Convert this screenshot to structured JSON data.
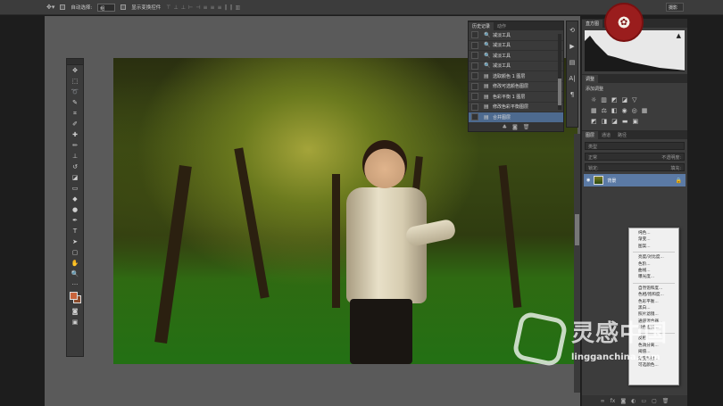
{
  "options_bar": {
    "auto_select_label": "自动选择:",
    "auto_select_value": "组",
    "show_transform_label": "显示变换控件",
    "workspace_value": "摄影"
  },
  "history_panel": {
    "tabs": [
      "历史记录",
      "动作"
    ],
    "items": [
      {
        "label": "减淡工具",
        "selected": false
      },
      {
        "label": "减淡工具",
        "selected": false
      },
      {
        "label": "减淡工具",
        "selected": false
      },
      {
        "label": "减淡工具",
        "selected": false
      },
      {
        "label": "选取颜色 1 图层",
        "selected": false
      },
      {
        "label": "修改可选颜色图层",
        "selected": false
      },
      {
        "label": "色彩平衡 1 图层",
        "selected": false
      },
      {
        "label": "修改色彩平衡图层",
        "selected": false
      },
      {
        "label": "合并图层",
        "selected": true
      }
    ]
  },
  "histogram_panel": {
    "tab": "直方图"
  },
  "adjustments_panel": {
    "tab": "调整",
    "title": "添加调整"
  },
  "layers_panel": {
    "tabs": [
      "图层",
      "通道",
      "路径"
    ],
    "kind_filter": "类型",
    "blend_mode": "正常",
    "opacity_label": "不透明度:",
    "lock_label": "锁定:",
    "fill_label": "填充:",
    "layer_name": "背景"
  },
  "context_menu": {
    "groups": [
      [
        "纯色...",
        "渐变...",
        "图案..."
      ],
      [
        "亮度/对比度...",
        "色阶...",
        "曲线...",
        "曝光度..."
      ],
      [
        "自然饱和度...",
        "色相/饱和度...",
        "色彩平衡...",
        "黑白...",
        "照片滤镜...",
        "通道混合器...",
        "颜色查找..."
      ],
      [
        "反相",
        "色调分离...",
        "阈值...",
        "渐变映射...",
        "可选颜色..."
      ]
    ]
  },
  "watermark": {
    "cn": "灵感中国",
    "en": "lingganchina.com"
  },
  "colors": {
    "foreground": "#c8643c",
    "background": "#8a4a2a",
    "selection": "#4d6a8f"
  }
}
